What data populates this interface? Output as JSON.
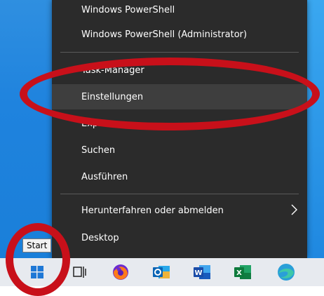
{
  "menu": {
    "items": [
      {
        "label": "Windows PowerShell"
      },
      {
        "label": "Windows PowerShell (Administrator)"
      },
      {
        "label": "Task-Manager"
      },
      {
        "label": "Einstellungen"
      },
      {
        "label": "Explorer"
      },
      {
        "label": "Suchen"
      },
      {
        "label": "Ausführen"
      },
      {
        "label": "Herunterfahren oder abmelden"
      },
      {
        "label": "Desktop"
      }
    ]
  },
  "tooltip": {
    "text": "Start"
  },
  "taskbar": {
    "icons": [
      "windows-start-icon",
      "task-view-icon",
      "firefox-icon",
      "outlook-icon",
      "word-icon",
      "excel-icon",
      "edge-icon"
    ]
  },
  "colors": {
    "menu_bg": "#2b2b2b",
    "hover_bg": "#3e3e3e",
    "annotation": "#c8101a",
    "desktop": "#1f83de",
    "taskbar": "#e7eaef"
  }
}
